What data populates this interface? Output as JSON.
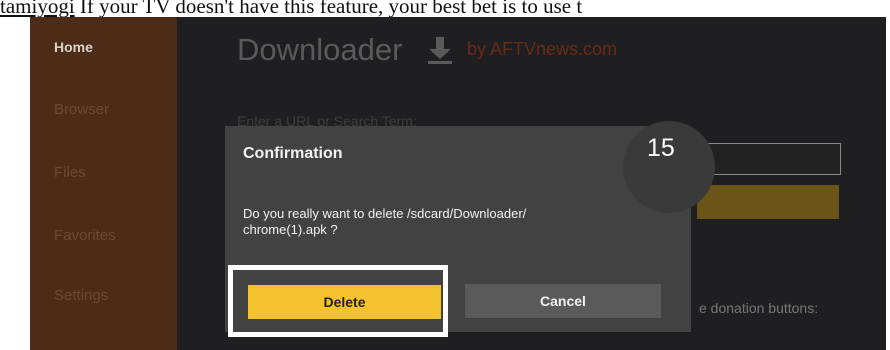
{
  "article": {
    "link_text": "tamiyogi",
    "rest_text": " If your TV doesn't have this feature, your best bet is to use t"
  },
  "sidebar": {
    "items": [
      {
        "label": "Home",
        "active": true
      },
      {
        "label": "Browser",
        "active": false
      },
      {
        "label": "Files",
        "active": false
      },
      {
        "label": "Favorites",
        "active": false
      },
      {
        "label": "Settings",
        "active": false
      }
    ]
  },
  "header": {
    "title": "Downloader",
    "byline": "by AFTVnews.com",
    "icon": "download-arrow-icon"
  },
  "main": {
    "url_label": "Enter a URL or Search Term:",
    "donation_text": "e donation buttons:"
  },
  "dialog": {
    "title": "Confirmation",
    "message": "Do you really want to delete /sdcard/Downloader/ chrome(1).apk ?",
    "delete_label": "Delete",
    "cancel_label": "Cancel"
  },
  "step_badge": "15",
  "colors": {
    "sidebar": "#4c2c17",
    "primary_button": "#f4c22f",
    "dialog": "#424242",
    "background": "#1f1f21"
  }
}
